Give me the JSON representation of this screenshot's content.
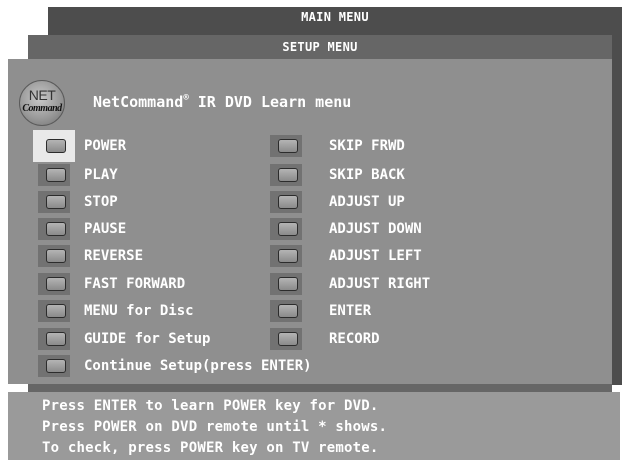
{
  "main_menu": {
    "title": "MAIN MENU"
  },
  "setup_menu": {
    "title": "SETUP MENU"
  },
  "learn_menu": {
    "logo": {
      "line1": "NET",
      "line2": "Command"
    },
    "title_brand": "NetCommand",
    "title_mark": "®",
    "title_rest": " IR DVD Learn menu",
    "left_items": [
      "POWER",
      "PLAY",
      "STOP",
      "PAUSE",
      "REVERSE",
      "FAST FORWARD",
      "MENU for Disc",
      "GUIDE for Setup",
      "Continue Setup(press ENTER)"
    ],
    "right_items": [
      "SKIP FRWD",
      "SKIP BACK",
      "ADJUST UP",
      "ADJUST DOWN",
      "ADJUST LEFT",
      "ADJUST RIGHT",
      "ENTER",
      "RECORD"
    ],
    "selected": "POWER"
  },
  "help": {
    "lines": [
      "Press ENTER to learn POWER key for DVD.",
      "Press POWER on DVD remote until * shows.",
      "To check, press POWER key on TV remote."
    ]
  },
  "colors": {
    "main_panel": "#4d4d4d",
    "setup_panel": "#666666",
    "learn_panel": "#8f8f8f",
    "help_panel": "#9a9a9a",
    "selection": "#e9e9e9",
    "text": "#ffffff"
  }
}
